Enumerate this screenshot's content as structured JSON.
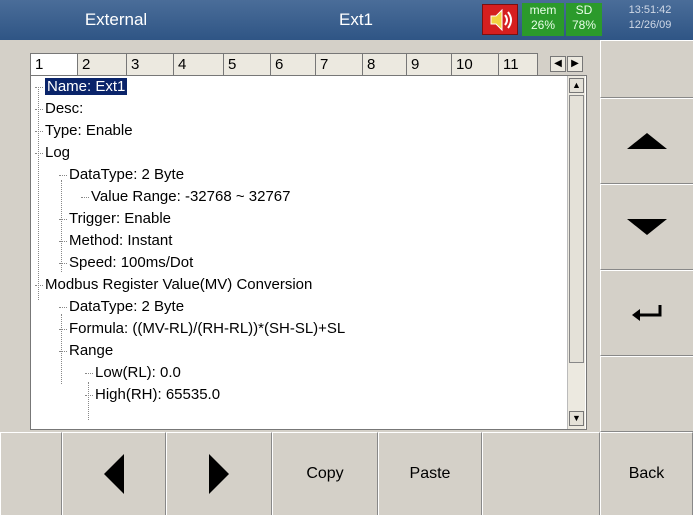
{
  "header": {
    "left_title": "External",
    "center_title": "Ext1",
    "mem_label": "mem",
    "mem_value": "26%",
    "sd_label": "SD",
    "sd_value": "78%",
    "time": "13:51:42",
    "date": "12/26/09"
  },
  "tabs": [
    "1",
    "2",
    "3",
    "4",
    "5",
    "6",
    "7",
    "8",
    "9",
    "10",
    "11"
  ],
  "active_tab": "1",
  "tree": [
    {
      "text": "Name: Ext1",
      "level": 0,
      "selected": true
    },
    {
      "text": "Desc:",
      "level": 0
    },
    {
      "text": "Type: Enable",
      "level": 0
    },
    {
      "text": "Log",
      "level": 0
    },
    {
      "text": "DataType: 2 Byte",
      "level": 1
    },
    {
      "text": "Value Range: -32768 ~ 32767",
      "level": 2
    },
    {
      "text": "Trigger: Enable",
      "level": 1
    },
    {
      "text": "Method: Instant",
      "level": 1
    },
    {
      "text": "Speed: 100ms/Dot",
      "level": 1
    },
    {
      "text": "Modbus Register Value(MV) Conversion",
      "level": 0
    },
    {
      "text": "DataType: 2 Byte",
      "level": 1
    },
    {
      "text": "Formula: ((MV-RL)/(RH-RL))*(SH-SL)+SL",
      "level": 1
    },
    {
      "text": "Range",
      "level": 1
    },
    {
      "text": "Low(RL): 0.0",
      "level": 2
    },
    {
      "text": "High(RH): 65535.0",
      "level": 2
    }
  ],
  "buttons": {
    "copy": "Copy",
    "paste": "Paste",
    "back": "Back"
  },
  "icons": {
    "speaker": "speaker-icon",
    "up": "arrow-up-icon",
    "down": "arrow-down-icon",
    "enter": "enter-icon",
    "left": "arrow-left-icon",
    "right": "arrow-right-icon"
  },
  "colors": {
    "header": "#2f5585",
    "selection": "#0a246a",
    "speaker_bg": "#d51f1f",
    "storage_bg": "#2b9a2b"
  }
}
